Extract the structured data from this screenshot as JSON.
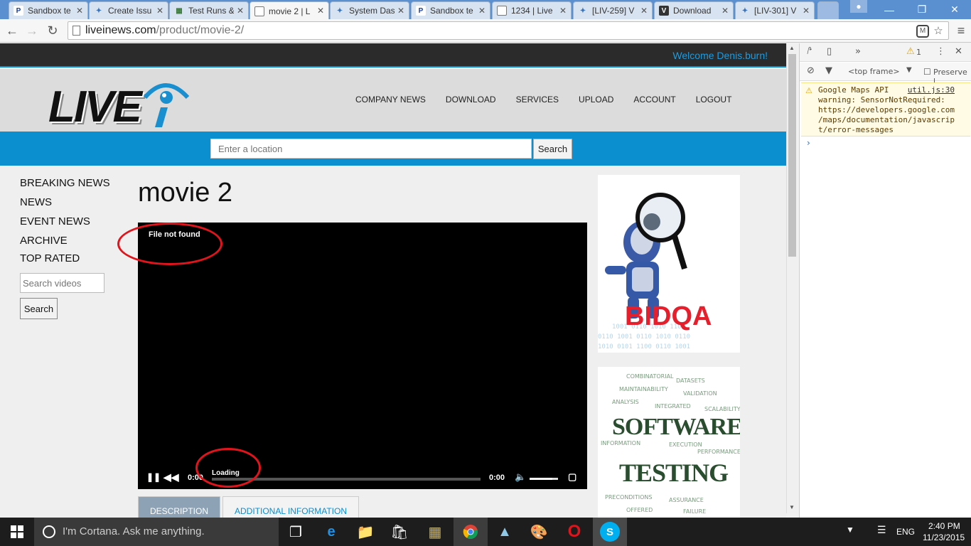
{
  "browser": {
    "tabs": [
      {
        "label": "Sandbox te",
        "icon": "paypal-icon"
      },
      {
        "label": "Create Issu",
        "icon": "jira-icon"
      },
      {
        "label": "Test Runs &",
        "icon": "testrail-icon"
      },
      {
        "label": "movie 2 | L",
        "icon": "page-icon",
        "active": true
      },
      {
        "label": "System Das",
        "icon": "jira-icon"
      },
      {
        "label": "Sandbox te",
        "icon": "paypal-icon"
      },
      {
        "label": "1234 | Live",
        "icon": "page-icon"
      },
      {
        "label": "[LIV-259] V",
        "icon": "jira-icon"
      },
      {
        "label": "Download",
        "icon": "vimeo-icon"
      },
      {
        "label": "[LIV-301] V",
        "icon": "jira-icon"
      }
    ],
    "url_host": "liveinews.com",
    "url_path": "/product/movie-2/"
  },
  "site": {
    "welcome": "Welcome Denis.burn!",
    "logo_text": "LIVE",
    "nav": [
      "COMPANY NEWS",
      "DOWNLOAD",
      "SERVICES",
      "UPLOAD",
      "ACCOUNT",
      "LOGOUT"
    ],
    "location_placeholder": "Enter a location",
    "location_search": "Search",
    "sidebar": [
      "BREAKING NEWS",
      "NEWS",
      "EVENT NEWS",
      "ARCHIVE",
      "TOP RATED"
    ],
    "video_search_placeholder": "Search videos",
    "video_search_button": "Search",
    "page_title": "movie 2",
    "player": {
      "error": "File not found",
      "loading": "Loading",
      "current_time": "0:00",
      "duration": "0:00",
      "volume": 0.8
    },
    "content_tabs": [
      "DESCRIPTION",
      "ADDITIONAL INFORMATION"
    ],
    "ads": {
      "bidqa_text": "BIDQA",
      "testing_word1": "SOFTWARE",
      "testing_word2": "TESTING"
    }
  },
  "devtools": {
    "frame": "<top frame>",
    "preserve_log": "Preserve l",
    "warning_count": "1",
    "warning_text": "Google Maps API warning: SensorNotRequired: https://developers.google.com/maps/documentation/javascript/error-messages",
    "warning_lines": [
      "Google Maps API",
      "warning: SensorNotRequired:",
      "https://developers.google.com",
      "/maps/documentation/javascrip",
      "t/error-messages"
    ],
    "warning_source": "util.js:30",
    "prompt": "›"
  },
  "taskbar": {
    "cortana": "I'm Cortana. Ask me anything.",
    "language": "ENG",
    "time": "2:40 PM",
    "date": "11/23/2015"
  },
  "colors": {
    "accent": "#0b8fce",
    "annotation": "#e0141c"
  }
}
